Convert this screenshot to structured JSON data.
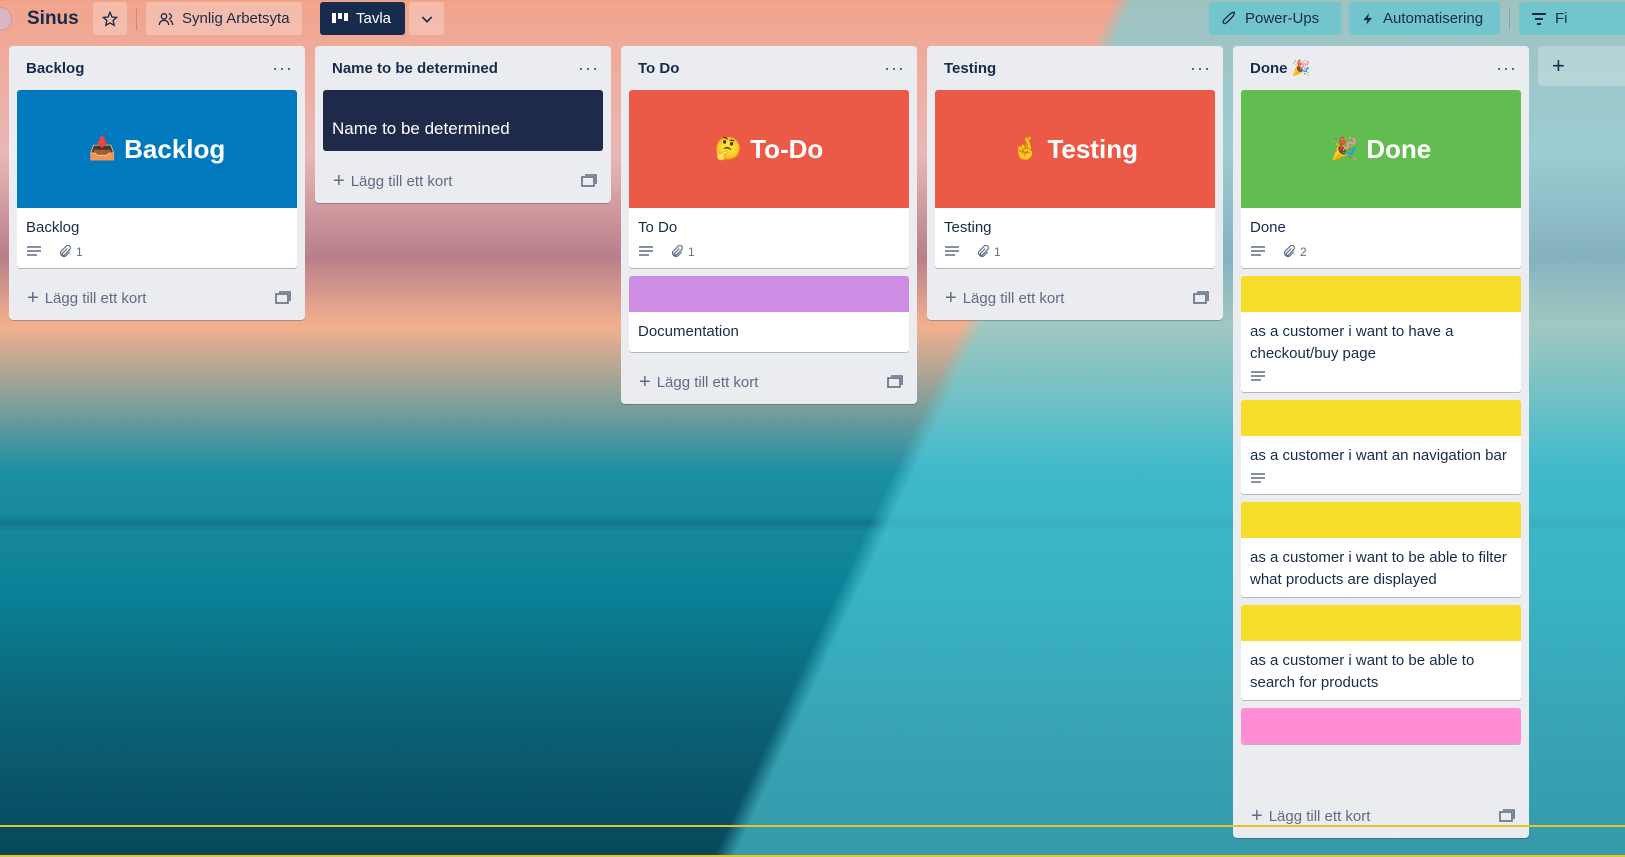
{
  "board": {
    "title": "Sinus",
    "visibility_label": "Synlig Arbetsyta",
    "view_label": "Tavla",
    "powerups_label": "Power-Ups",
    "automation_label": "Automatisering",
    "filter_label": "Fi"
  },
  "colors": {
    "blue": "#0079bf",
    "navy": "#1f2a4a",
    "red": "#eb5a46",
    "green": "#61bd4f",
    "purple": "#cd8de5",
    "yellow": "#f5dd29",
    "pink": "#ff8ed4"
  },
  "add_card_label": "Lägg till ett kort",
  "lists": [
    {
      "title": "Backlog",
      "cards": [
        {
          "cover_emoji": "📥",
          "cover_text": "Backlog",
          "title": "Backlog",
          "attachments": "1"
        }
      ]
    },
    {
      "title": "Name to be determined",
      "cards": [
        {
          "title": "Name to be determined"
        }
      ]
    },
    {
      "title": "To Do",
      "cards": [
        {
          "cover_emoji": "🤔",
          "cover_text": "To-Do",
          "title": "To Do",
          "attachments": "1"
        },
        {
          "title": "Documentation"
        }
      ]
    },
    {
      "title": "Testing",
      "cards": [
        {
          "cover_emoji": "🤞",
          "cover_text": "Testing",
          "title": "Testing",
          "attachments": "1"
        }
      ]
    },
    {
      "title": "Done 🎉",
      "cards": [
        {
          "cover_emoji": "🎉",
          "cover_text": "Done",
          "title": "Done",
          "attachments": "2"
        },
        {
          "title": "as a customer i want to have a checkout/buy page"
        },
        {
          "title": "as a customer i want an navigation bar"
        },
        {
          "title": "as a customer i want to be able to filter what products are displayed"
        },
        {
          "title": "as a customer i want to be able to search for products"
        }
      ]
    }
  ]
}
